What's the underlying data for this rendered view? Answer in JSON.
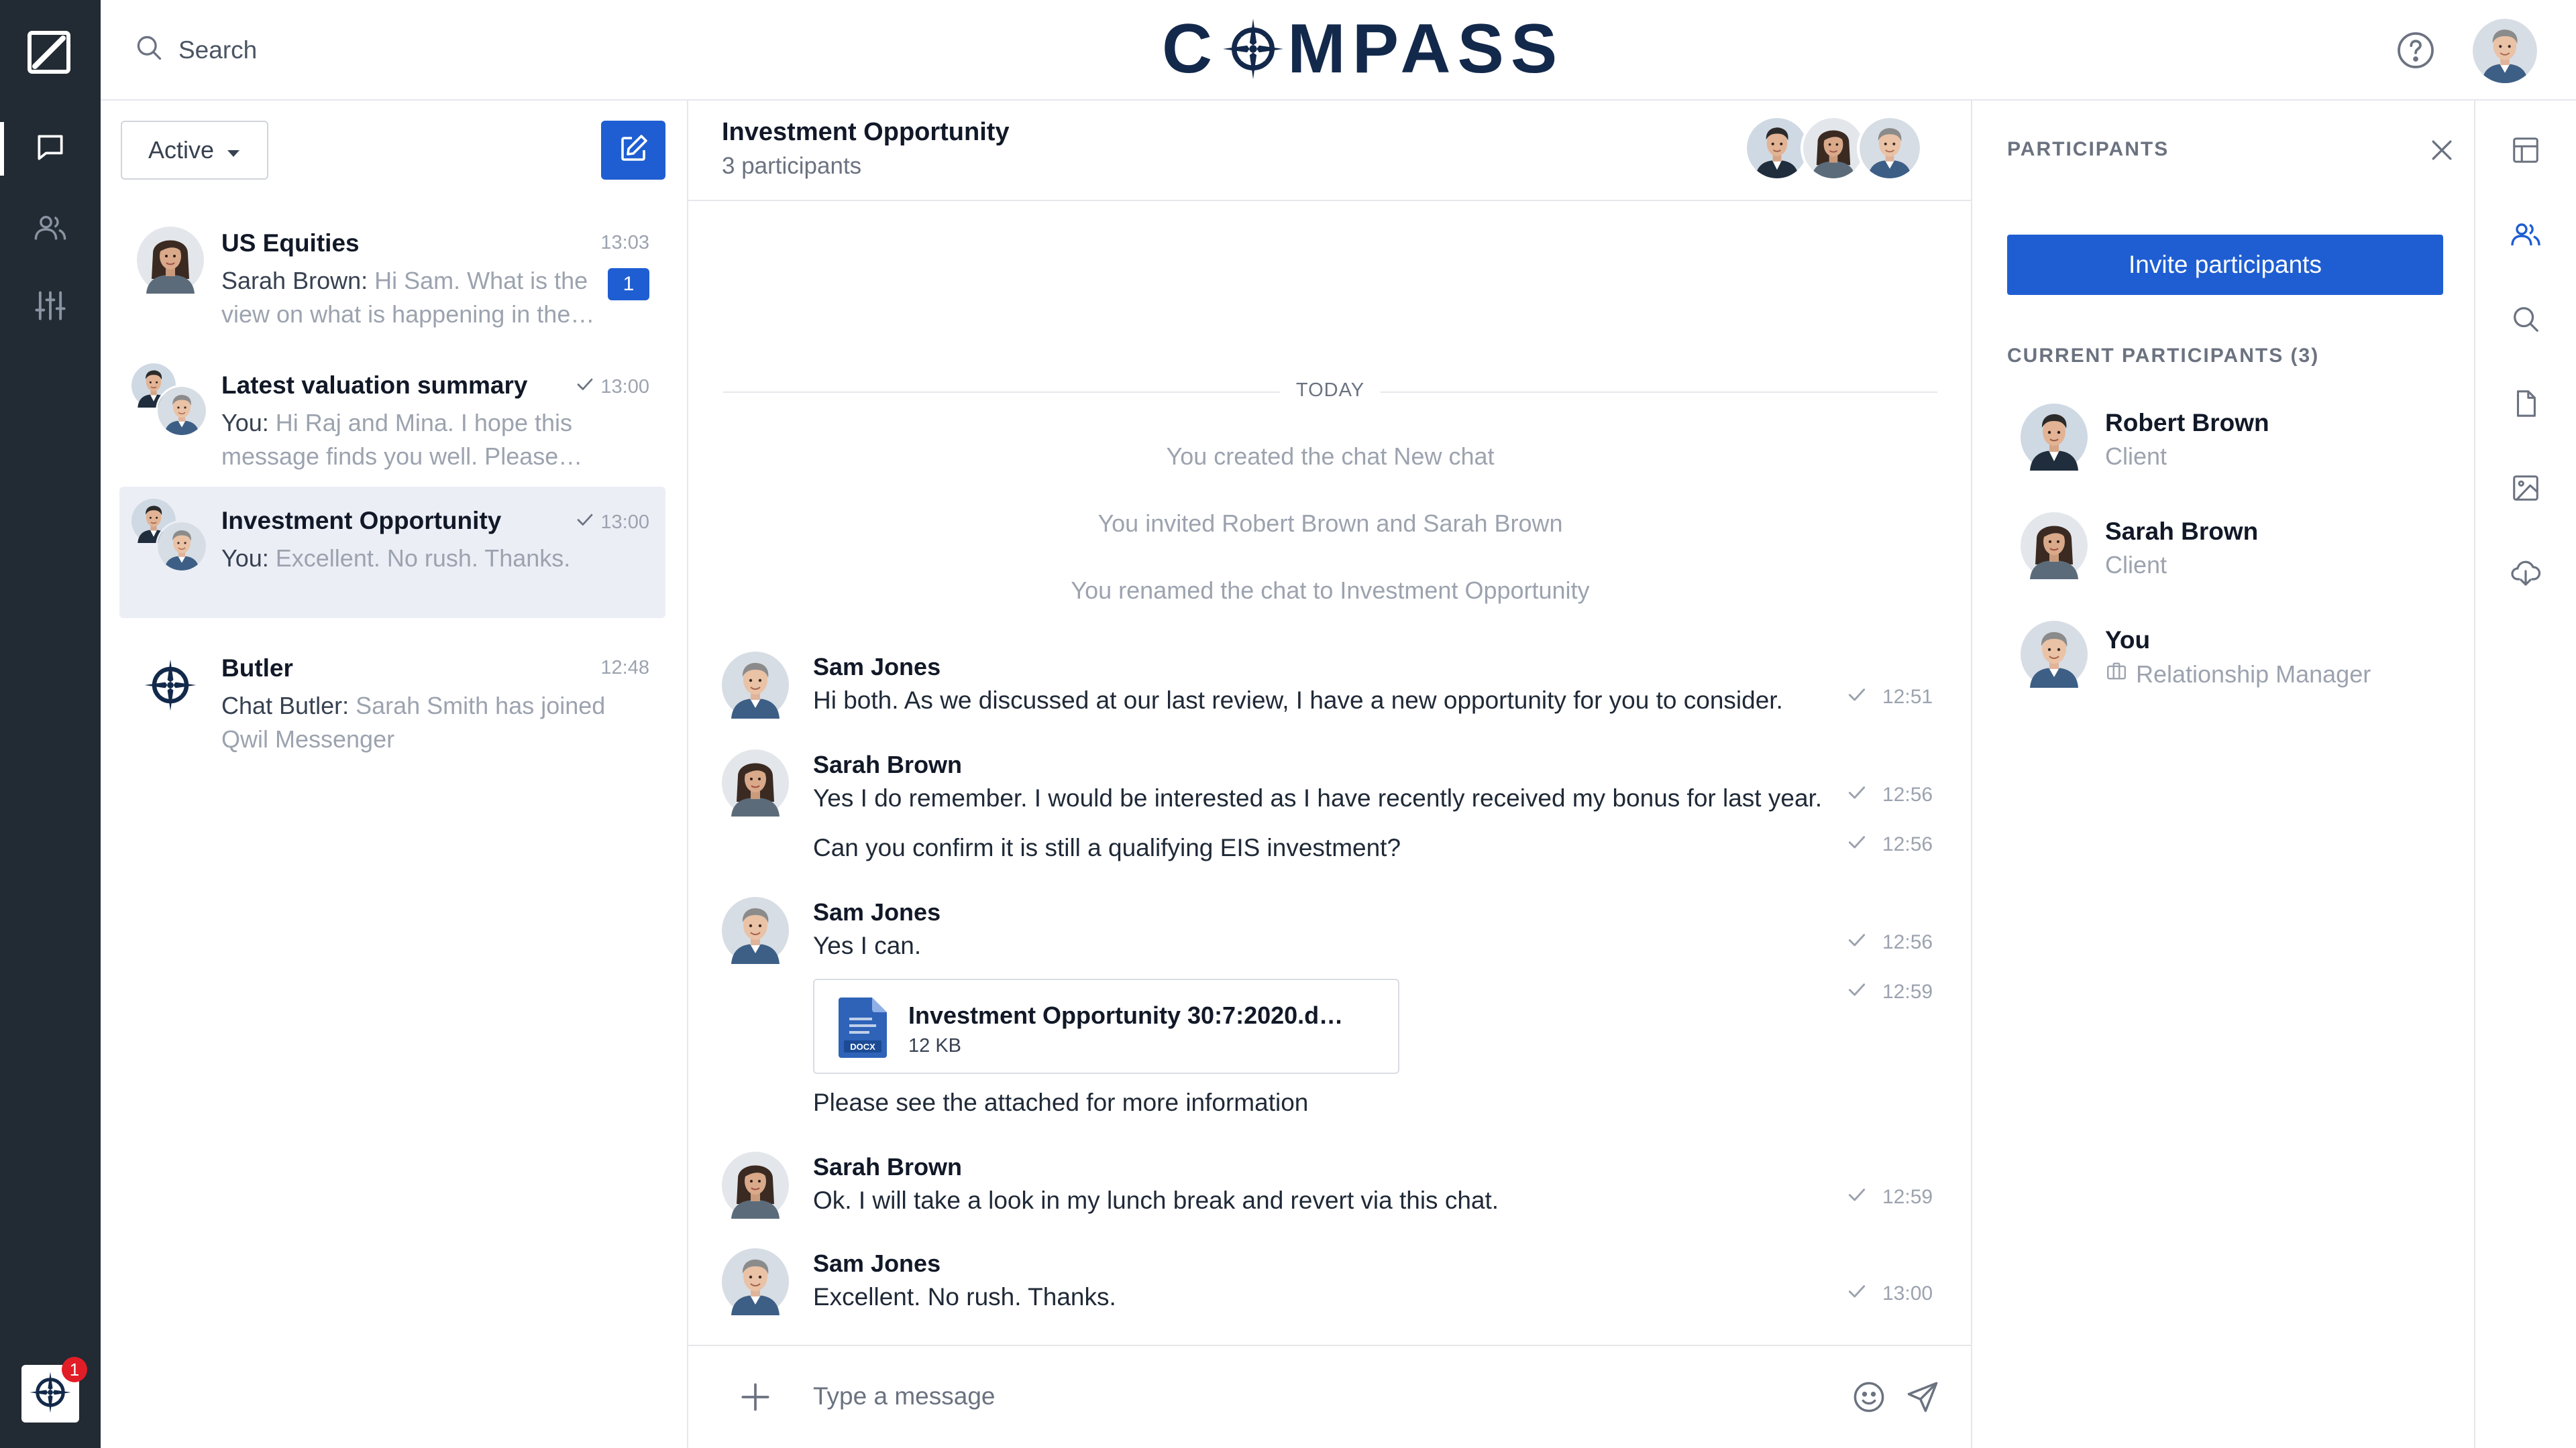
{
  "app": {
    "brand_before": "C",
    "brand_after": "MPASS",
    "rail_badge": "1"
  },
  "topbar": {
    "search_placeholder": "Search"
  },
  "conversation_list": {
    "filter_label": "Active",
    "items": [
      {
        "title": "US Equities",
        "time": "13:03",
        "sender": "Sarah Brown:",
        "preview": " Hi Sam. What is the view on what is happening in the…",
        "unread": "1",
        "read_tick": false,
        "active": false
      },
      {
        "title": "Latest valuation summary",
        "time": "13:00",
        "sender": "You:",
        "preview": " Hi Raj and Mina. I hope this message finds you well. Please…",
        "unread": null,
        "read_tick": true,
        "active": false
      },
      {
        "title": "Investment Opportunity",
        "time": "13:00",
        "sender": "You:",
        "preview": " Excellent. No rush. Thanks.",
        "unread": null,
        "read_tick": true,
        "active": true
      },
      {
        "title": "Butler",
        "time": "12:48",
        "sender": "Chat Butler:",
        "preview": " Sarah Smith has joined Qwil Messenger",
        "unread": null,
        "read_tick": false,
        "active": false
      }
    ]
  },
  "chat": {
    "title": "Investment Opportunity",
    "subtitle": "3 participants",
    "day_divider": "TODAY",
    "system_messages": [
      "You created the chat New chat",
      "You invited Robert Brown and Sarah Brown",
      "You renamed the chat to Investment Opportunity"
    ],
    "messages": [
      {
        "sender": "Sam Jones",
        "lines": [
          {
            "text": "Hi both. As we discussed at our last review, I have a new opportunity for you to consider.",
            "time": "12:51"
          }
        ]
      },
      {
        "sender": "Sarah Brown",
        "lines": [
          {
            "text": "Yes I do remember. I would be interested as I have recently received my bonus for last year.",
            "time": "12:56"
          },
          {
            "text": "Can you confirm it is still a qualifying EIS investment?",
            "time": "12:56"
          }
        ]
      },
      {
        "sender": "Sam Jones",
        "lines": [
          {
            "text": "Yes I can.",
            "time": "12:56"
          },
          {
            "text": "Please see the attached for more information",
            "time": "12:59"
          }
        ],
        "attachment": {
          "name": "Investment Opportunity 30:7:2020.d…",
          "size": "12 KB",
          "type_label": "DOCX"
        }
      },
      {
        "sender": "Sarah Brown",
        "lines": [
          {
            "text": "Ok. I will take a look in my lunch break and revert via this chat.",
            "time": "12:59"
          }
        ]
      },
      {
        "sender": "Sam Jones",
        "lines": [
          {
            "text": "Excellent. No rush. Thanks.",
            "time": "13:00"
          }
        ]
      }
    ],
    "composer_placeholder": "Type a message"
  },
  "participants_panel": {
    "header": "PARTICIPANTS",
    "invite_label": "Invite participants",
    "current_header": "CURRENT PARTICIPANTS (3)",
    "people": [
      {
        "name": "Robert Brown",
        "role": "Client"
      },
      {
        "name": "Sarah Brown",
        "role": "Client"
      },
      {
        "name": "You",
        "role": "Relationship Manager"
      }
    ]
  },
  "colors": {
    "rail_bg": "#222a33",
    "accent": "#1f5ed2",
    "brand_navy": "#13294b",
    "active_row": "#eceef6",
    "badge_red": "#e11d27"
  }
}
